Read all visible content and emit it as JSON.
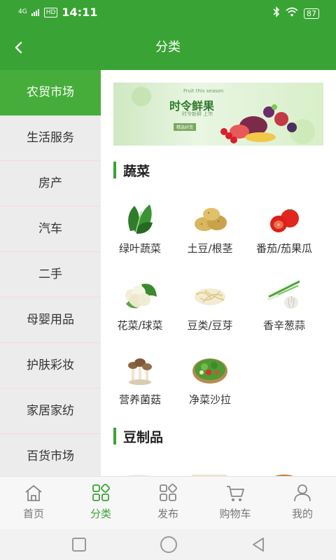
{
  "status": {
    "network": "4G",
    "hd": "HD",
    "time": "14:11",
    "battery": "87"
  },
  "header": {
    "title": "分类"
  },
  "sidebar": {
    "items": [
      {
        "label": "农贸市场",
        "active": true
      },
      {
        "label": "生活服务"
      },
      {
        "label": "房产"
      },
      {
        "label": "汽车"
      },
      {
        "label": "二手"
      },
      {
        "label": "母婴用品"
      },
      {
        "label": "护肤彩妆"
      },
      {
        "label": "家居家纺"
      },
      {
        "label": "百货市场"
      }
    ]
  },
  "banner": {
    "title": "时令鲜果",
    "subtitle": "Fruit this season",
    "tagline": "时令新鲜 上市",
    "tag": "精选好货"
  },
  "sections": [
    {
      "title": "蔬菜",
      "items": [
        {
          "label": "绿叶蔬菜",
          "icon": "leafy-greens-icon"
        },
        {
          "label": "土豆/根茎",
          "icon": "potato-icon"
        },
        {
          "label": "番茄/茄果瓜",
          "icon": "tomato-icon"
        },
        {
          "label": "花菜/球菜",
          "icon": "cauliflower-icon"
        },
        {
          "label": "豆类/豆芽",
          "icon": "bean-sprout-icon"
        },
        {
          "label": "香辛葱蒜",
          "icon": "scallion-garlic-icon"
        },
        {
          "label": "营养菌菇",
          "icon": "mushroom-icon"
        },
        {
          "label": "净菜沙拉",
          "icon": "salad-icon"
        }
      ]
    },
    {
      "title": "豆制品"
    }
  ],
  "tabs": [
    {
      "label": "首页",
      "icon": "home-icon"
    },
    {
      "label": "分类",
      "icon": "category-icon",
      "active": true
    },
    {
      "label": "发布",
      "icon": "publish-icon"
    },
    {
      "label": "购物车",
      "icon": "cart-icon"
    },
    {
      "label": "我的",
      "icon": "user-icon"
    }
  ],
  "colors": {
    "brand": "#3aa335",
    "sidebar_active": "#46ad3a"
  }
}
